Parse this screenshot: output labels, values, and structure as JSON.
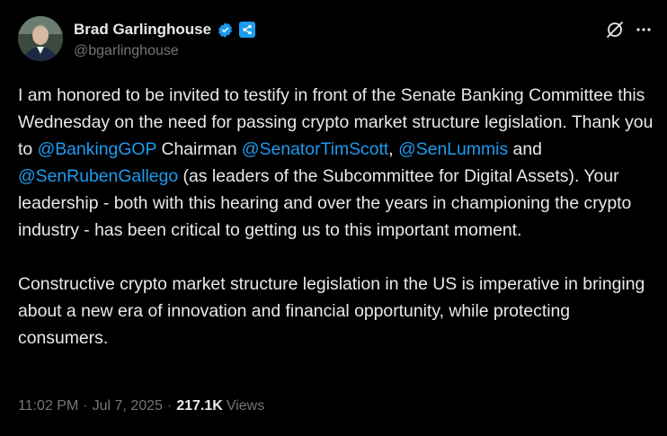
{
  "author": {
    "display_name": "Brad Garlinghouse",
    "handle": "@bgarlinghouse",
    "verified_badge_color": "#1d9bf0",
    "affiliation_badge_color": "#1d9bf0"
  },
  "actions": {
    "grok_icon": "grok-icon",
    "more_icon": "more-icon"
  },
  "body": {
    "p1": {
      "t1": "I am honored to be invited to testify in front of the Senate Banking Committee this Wednesday on the need for passing crypto market structure legislation. Thank you to ",
      "m1": "@BankingGOP",
      "t2": " Chairman ",
      "m2": "@SenatorTimScott",
      "t3": ", ",
      "m3": "@SenLummis",
      "t4": " and ",
      "m4": "@SenRubenGallego",
      "t5": " (as leaders of the Subcommittee for Digital Assets). Your leadership - both with this hearing and over the years in championing the crypto industry - has been critical to getting us to this important moment."
    },
    "p2": "Constructive crypto market structure legislation in the US is imperative in bringing about a new era of innovation and financial opportunity, while protecting consumers."
  },
  "meta": {
    "time": "11:02 PM",
    "date": "Jul 7, 2025",
    "separator": "·",
    "views_count": "217.1K",
    "views_label": "Views"
  },
  "colors": {
    "background": "#000000",
    "text": "#e7e9ea",
    "secondary": "#71767b",
    "link": "#1d9bf0"
  }
}
